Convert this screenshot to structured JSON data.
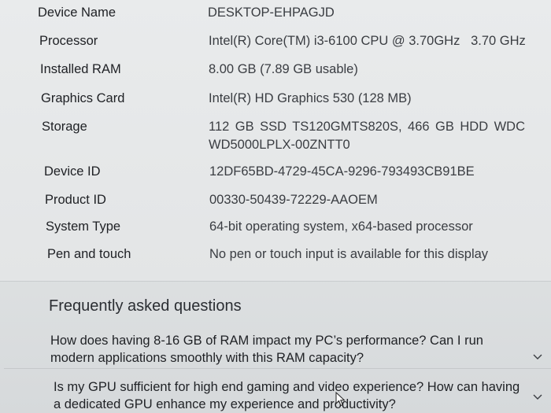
{
  "specs": [
    {
      "label": "Device Name",
      "value": "DESKTOP-EHPAGJD"
    },
    {
      "label": "Processor",
      "value": "Intel(R) Core(TM) i3-6100 CPU @ 3.70GHz   3.70 GHz"
    },
    {
      "label": "Installed RAM",
      "value": "8.00 GB (7.89 GB usable)"
    },
    {
      "label": "Graphics Card",
      "value": "Intel(R) HD Graphics 530 (128 MB)"
    },
    {
      "label": "Storage",
      "value": "112 GB SSD TS120GMTS820S, 466 GB HDD WDC WD5000LPLX-00ZNTT0"
    },
    {
      "label": "Device ID",
      "value": "12DF65BD-4729-45CA-9296-793493CB91BE"
    },
    {
      "label": "Product ID",
      "value": "00330-50439-72229-AAOEM"
    },
    {
      "label": "System Type",
      "value": "64-bit operating system, x64-based processor"
    },
    {
      "label": "Pen and touch",
      "value": "No pen or touch input is available for this display"
    }
  ],
  "faq": {
    "title": "Frequently asked questions",
    "items": [
      {
        "question": "How does having 8-16 GB of RAM impact my PC’s performance? Can I run modern applications smoothly with this RAM capacity?"
      },
      {
        "question": "Is my GPU sufficient for high end gaming and video experience? How can having a dedicated GPU enhance my experience and productivity?"
      }
    ]
  },
  "icons": {
    "expand": "chevron-down-icon",
    "pointer": "mouse-cursor-icon"
  },
  "colors": {
    "background": "#e4e6e7",
    "text": "#1f2125",
    "divider": "#c5c8ca"
  }
}
